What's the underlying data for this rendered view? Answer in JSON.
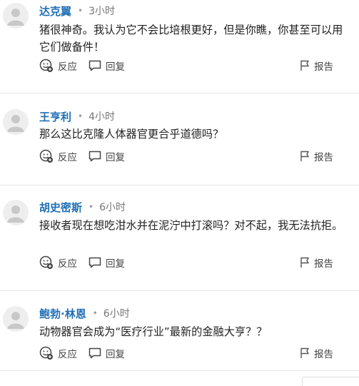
{
  "actions": {
    "react_label": "反应",
    "reply_label": "回复",
    "report_label": "报告"
  },
  "comments": [
    {
      "author": "达克翼",
      "time": "3小时",
      "text": "猪很神奇。我认为它不会比培根更好，但是你瞧，你甚至可以用它们做备件！"
    },
    {
      "author": "王亨利",
      "time": "4小时",
      "text": "那么这比克隆人体器官更合乎道德吗？"
    },
    {
      "author": "胡史密斯",
      "time": "6小时",
      "text": "接收者现在想吃泔水并在泥泞中打滚吗？对不起，我无法抗拒。"
    },
    {
      "author": "鲍勃·林恩",
      "time": "6小时",
      "text": "动物器官会成为“医疗行业”最新的金融大亨？？"
    }
  ],
  "icons": {
    "avatar": "default-user-icon",
    "react": "emoji-add-icon",
    "reply": "speech-bubble-icon",
    "report": "flag-icon"
  },
  "colors": {
    "author": "#1f6fb5",
    "divider": "#e6e6e6",
    "avatar_bg": "#eeeeee"
  }
}
